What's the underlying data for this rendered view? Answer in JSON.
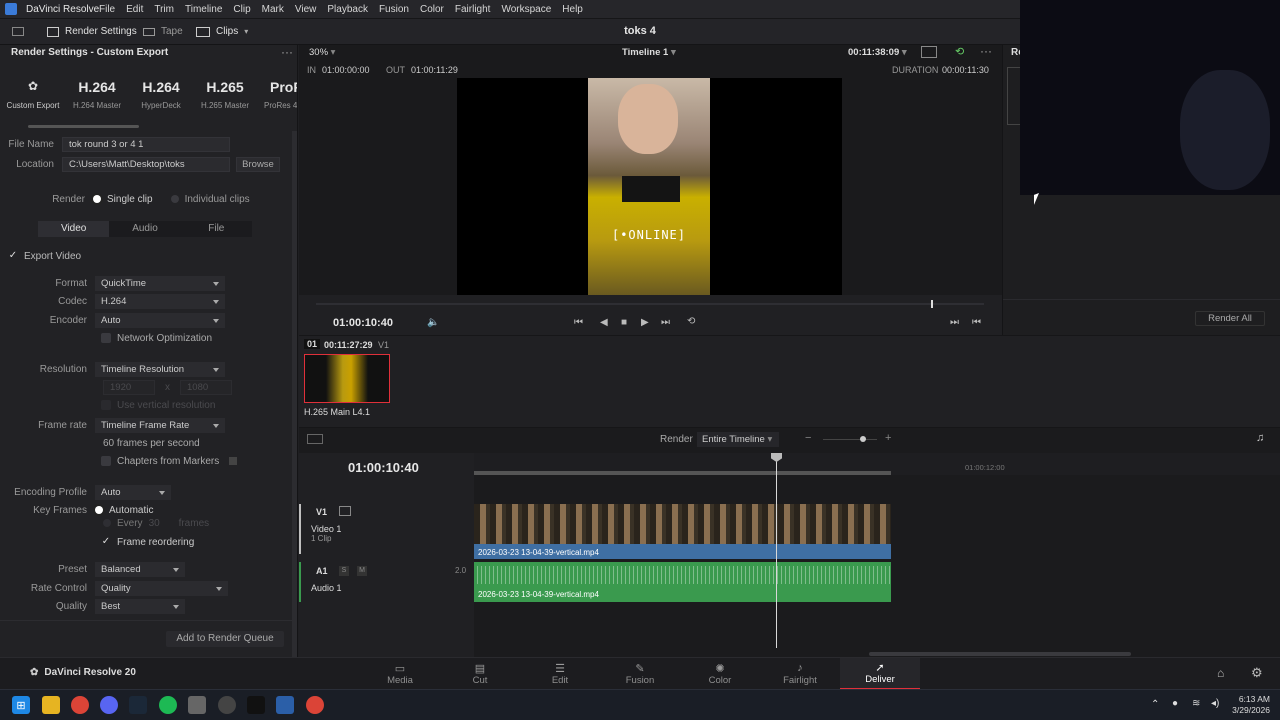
{
  "app": {
    "name": "DaVinci Resolve",
    "project_title": "toks 4"
  },
  "menu": [
    "File",
    "Edit",
    "Trim",
    "Timeline",
    "Clip",
    "Mark",
    "View",
    "Playback",
    "Fusion",
    "Color",
    "Fairlight",
    "Workspace",
    "Help"
  ],
  "toolbar": {
    "render_settings": "Render Settings",
    "tape": "Tape",
    "clips": "Clips"
  },
  "render_panel": {
    "title": "Render Settings - Custom Export",
    "presets": [
      {
        "big": "",
        "small": "Custom Export"
      },
      {
        "big": "H.264",
        "small": "H.264 Master"
      },
      {
        "big": "H.264",
        "small": "HyperDeck"
      },
      {
        "big": "H.265",
        "small": "H.265 Master"
      },
      {
        "big": "ProRe",
        "small": "ProRes 42"
      }
    ],
    "file_name_label": "File Name",
    "file_name": "tok round 3 or 4 1",
    "location_label": "Location",
    "location": "C:\\Users\\Matt\\Desktop\\toks",
    "browse": "Browse",
    "render_label": "Render",
    "single_clip": "Single clip",
    "individual_clips": "Individual clips",
    "tabs": [
      "Video",
      "Audio",
      "File"
    ],
    "export_video": "Export Video",
    "format_label": "Format",
    "format": "QuickTime",
    "codec_label": "Codec",
    "codec": "H.264",
    "encoder_label": "Encoder",
    "encoder": "Auto",
    "network_opt": "Network Optimization",
    "resolution_label": "Resolution",
    "resolution": "Timeline Resolution",
    "res_w": "1920",
    "res_x": "x",
    "res_h": "1080",
    "vertical_res": "Use vertical resolution",
    "frame_rate_label": "Frame rate",
    "frame_rate": "Timeline Frame Rate",
    "fps_text": "60 frames per second",
    "chapters": "Chapters from Markers",
    "enc_profile_label": "Encoding Profile",
    "enc_profile": "Auto",
    "key_frames_label": "Key Frames",
    "kf_auto": "Automatic",
    "kf_every": "Every",
    "kf_num": "30",
    "kf_frames": "frames",
    "frame_reordering": "Frame reordering",
    "preset_label": "Preset",
    "preset": "Balanced",
    "rate_control_label": "Rate Control",
    "rate_control": "Quality",
    "quality_label": "Quality",
    "quality": "Best",
    "add_queue": "Add to Render Queue"
  },
  "viewer": {
    "zoom": "30%",
    "timeline_name": "Timeline 1",
    "timecode_top": "00:11:38:09",
    "in_label": "IN",
    "in_tc": "01:00:00:00",
    "out_label": "OUT",
    "out_tc": "01:00:11:29",
    "duration_label": "DURATION",
    "duration": "00:00:11:30",
    "overlay_text": "[•ONLINE]",
    "playhead_tc": "01:00:10:40",
    "scrub_position": 0.92
  },
  "right_panel": {
    "header": "Re",
    "render_all": "Render All"
  },
  "clip_bin": {
    "index": "01",
    "tc": "00:11:27:29",
    "track": "V1",
    "codec_label": "H.265 Main L4.1"
  },
  "timeline": {
    "render_label": "Render",
    "render_range": "Entire Timeline",
    "tc": "01:00:10:40",
    "ruler_mark": "01:00:12:00",
    "v1": {
      "tag": "V1",
      "name": "Video 1",
      "clips": "1 Clip",
      "clip_name": "2026-03-23 13-04-39-vertical.mp4"
    },
    "a1": {
      "tag": "A1",
      "s": "S",
      "m": "M",
      "level": "2.0",
      "name": "Audio 1",
      "clip_name": "2026-03-23 13-04-39-vertical.mp4"
    }
  },
  "pages": [
    "Media",
    "Cut",
    "Edit",
    "Fusion",
    "Color",
    "Fairlight",
    "Deliver"
  ],
  "brand_bottom": "DaVinci Resolve 20",
  "taskbar": {
    "time": "6:13 AM",
    "date": "3/29/2026"
  },
  "colors": {
    "accent": "#e0303a",
    "video_track": "#3f6fa3",
    "audio_track": "#3a9a4e",
    "playhead": "#d8d8d8"
  }
}
